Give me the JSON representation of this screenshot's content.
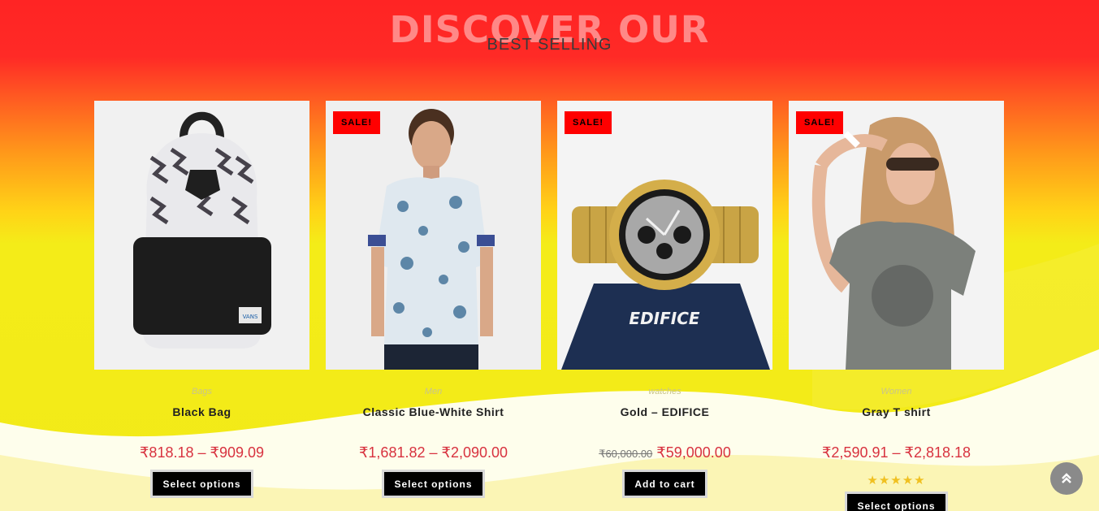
{
  "section": {
    "title": "DISCOVER OUR",
    "subtitle": "BEST SELLING"
  },
  "products": [
    {
      "sale": "",
      "category": "Bags",
      "name": "Black Bag",
      "old_price": "",
      "price": "₹818.18 – ₹909.09",
      "rating": "",
      "button": "Select options",
      "image_icon": "backpack-image"
    },
    {
      "sale": "SALE!",
      "category": "Men",
      "name": "Classic Blue-White Shirt",
      "old_price": "",
      "price": "₹1,681.82 – ₹2,090.00",
      "rating": "",
      "button": "Select options",
      "image_icon": "shirt-model-image"
    },
    {
      "sale": "SALE!",
      "category": "watches",
      "name": "Gold – EDIFICE",
      "old_price": "₹60,000.00",
      "price": "₹59,000.00",
      "rating": "",
      "button": "Add to cart",
      "image_icon": "gold-watch-image",
      "brand_text": "EDIFICE"
    },
    {
      "sale": "SALE!",
      "category": "Women",
      "name": "Gray T shirt",
      "old_price": "",
      "price": "₹2,590.91 – ₹2,818.18",
      "rating": "★★★★★",
      "button": "Select options",
      "image_icon": "woman-tshirt-image"
    }
  ],
  "colors": {
    "sale_badge": "#ff0000",
    "price": "#d8323f",
    "button": "#000000"
  },
  "scroll_top_icon": "double-chevron-up-icon"
}
